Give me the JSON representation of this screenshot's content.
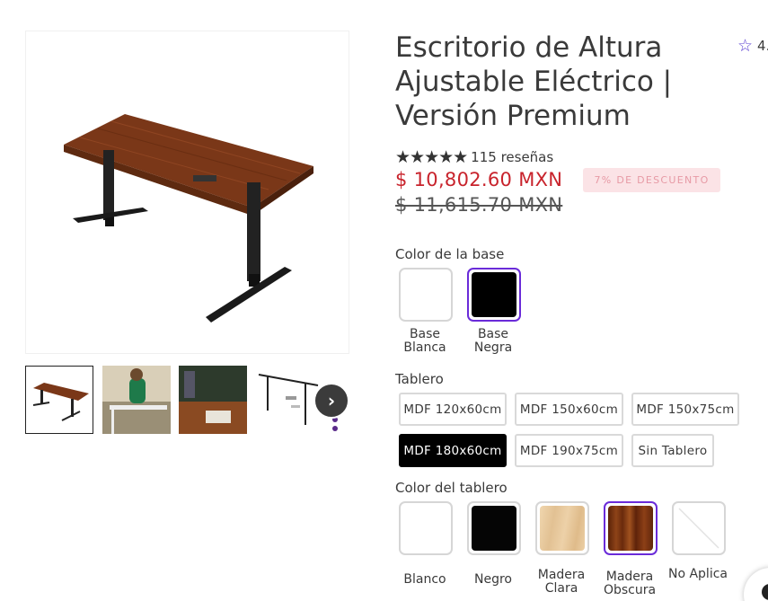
{
  "product": {
    "title": "Escritorio de Altura Ajustable Eléctrico | Versión Premium",
    "top_rating": "4.",
    "review_stars": "★★★★★",
    "review_count": "115 reseñas",
    "price": "$ 10,802.60 MXN",
    "discount_badge": "7% DE DESCUENTO",
    "old_price": "$ 11,615.70 MXN"
  },
  "gallery": {
    "next_icon": "›",
    "accent": "#6a2bd9"
  },
  "base_color": {
    "label": "Color de la base",
    "options": [
      {
        "caption": "Base Blanca",
        "color": "#ffffff"
      },
      {
        "caption": "Base Negra",
        "color": "#000000",
        "selected": true
      }
    ]
  },
  "tablero": {
    "label": "Tablero",
    "options": [
      "MDF 120x60cm",
      "MDF 150x60cm",
      "MDF 150x75cm",
      "MDF 180x60cm",
      "MDF 190x75cm",
      "Sin Tablero"
    ],
    "selected": "MDF 180x60cm"
  },
  "tablero_color": {
    "label": "Color del tablero",
    "options": [
      {
        "caption": "Blanco",
        "color": "#ffffff"
      },
      {
        "caption": "Negro",
        "color": "#050505"
      },
      {
        "caption": "Madera Clara",
        "color": "#e6c89e"
      },
      {
        "caption": "Madera Obscura",
        "color": "#7a3414",
        "selected": true
      },
      {
        "caption": "No Aplica",
        "color": "#ffffff"
      }
    ]
  },
  "colors": {
    "price": "#c8232c",
    "discount_bg": "#fbe3e6",
    "selected_border": "#6a2bd9"
  }
}
